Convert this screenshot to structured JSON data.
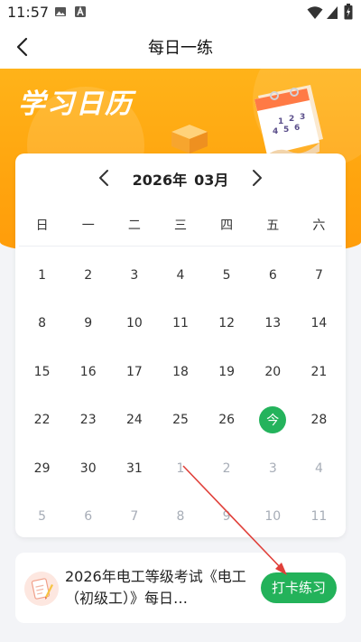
{
  "status_bar": {
    "time": "11:57",
    "icons": [
      "image-icon",
      "a-icon",
      "wifi-icon",
      "signal-icon",
      "battery-icon"
    ]
  },
  "nav": {
    "title": "每日一练",
    "back_icon": "chevron-left-icon"
  },
  "banner": {
    "title": "学习日历",
    "illustration_icon": "desk-calendar-icon",
    "illustration_digits": [
      "1",
      "2",
      "3",
      "4",
      "5",
      "6"
    ]
  },
  "calendar": {
    "year": "2026年",
    "month": "03月",
    "prev_icon": "chevron-left-icon",
    "next_icon": "chevron-right-icon",
    "weekdays": [
      "日",
      "一",
      "二",
      "三",
      "四",
      "五",
      "六"
    ],
    "weeks": [
      [
        {
          "t": "1"
        },
        {
          "t": "2"
        },
        {
          "t": "3"
        },
        {
          "t": "4"
        },
        {
          "t": "5"
        },
        {
          "t": "6"
        },
        {
          "t": "7"
        }
      ],
      [
        {
          "t": "8"
        },
        {
          "t": "9"
        },
        {
          "t": "10"
        },
        {
          "t": "11"
        },
        {
          "t": "12"
        },
        {
          "t": "13"
        },
        {
          "t": "14"
        }
      ],
      [
        {
          "t": "15"
        },
        {
          "t": "16"
        },
        {
          "t": "17"
        },
        {
          "t": "18"
        },
        {
          "t": "19"
        },
        {
          "t": "20"
        },
        {
          "t": "21"
        }
      ],
      [
        {
          "t": "22"
        },
        {
          "t": "23"
        },
        {
          "t": "24"
        },
        {
          "t": "25"
        },
        {
          "t": "26"
        },
        {
          "t": "今",
          "today": true
        },
        {
          "t": "28"
        }
      ],
      [
        {
          "t": "29"
        },
        {
          "t": "30"
        },
        {
          "t": "31"
        },
        {
          "t": "1",
          "other": true
        },
        {
          "t": "2",
          "other": true
        },
        {
          "t": "3",
          "other": true
        },
        {
          "t": "4",
          "other": true
        }
      ],
      [
        {
          "t": "5",
          "other": true
        },
        {
          "t": "6",
          "other": true
        },
        {
          "t": "7",
          "other": true
        },
        {
          "t": "8",
          "other": true
        },
        {
          "t": "9",
          "other": true
        },
        {
          "t": "10",
          "other": true
        },
        {
          "t": "11",
          "other": true
        }
      ]
    ],
    "today_color": "#24b35c"
  },
  "task": {
    "icon": "exam-paper-icon",
    "text": "2026年电工等级考试《电工（初级工）》每日…",
    "button_label": "打卡练习",
    "button_color": "#23b25a"
  },
  "colors": {
    "banner": "#ffa40e",
    "annotation_arrow": "#e0403a"
  }
}
